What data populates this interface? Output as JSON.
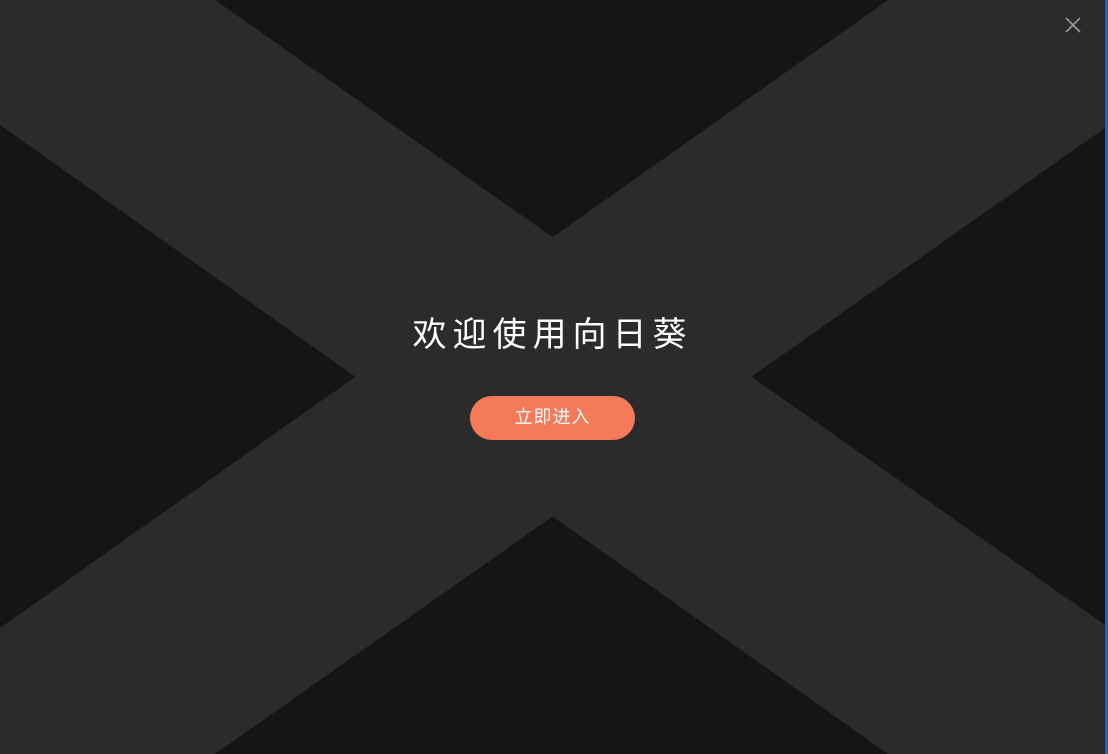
{
  "window": {
    "close_icon": "close-icon"
  },
  "welcome": {
    "title": "欢迎使用向日葵",
    "enter_button_label": "立即进入"
  },
  "colors": {
    "background_dark": "#151515",
    "background_band": "#2b2b2b",
    "accent": "#f47a59",
    "text": "#ffffff",
    "window_edge": "#2a5fb8"
  }
}
